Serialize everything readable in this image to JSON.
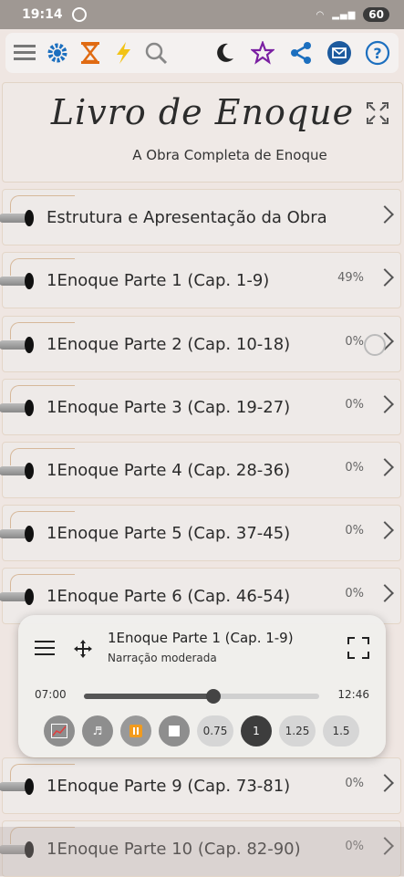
{
  "status": {
    "time": "19:14",
    "battery": "60"
  },
  "toolbar": {
    "left": [
      "menu-icon",
      "gear-icon",
      "hourglass-icon",
      "lightning-icon",
      "search-icon"
    ],
    "right": [
      "moon-icon",
      "star-icon",
      "share-icon",
      "mail-icon",
      "help-icon"
    ]
  },
  "header": {
    "title": "Livro de Enoque",
    "subtitle": "A Obra Completa de Enoque"
  },
  "rows": [
    {
      "label": "Estrutura e Apresentação da Obra",
      "pct": ""
    },
    {
      "label": "1Enoque Parte 1 (Cap. 1-9)",
      "pct": "49%"
    },
    {
      "label": "1Enoque Parte 2 (Cap. 10-18)",
      "pct": "0%"
    },
    {
      "label": "1Enoque Parte 3 (Cap. 19-27)",
      "pct": "0%"
    },
    {
      "label": "1Enoque Parte 4 (Cap. 28-36)",
      "pct": "0%"
    },
    {
      "label": "1Enoque Parte 5 (Cap. 37-45)",
      "pct": "0%"
    },
    {
      "label": "1Enoque Parte 6 (Cap. 46-54)",
      "pct": "0%"
    },
    {
      "label": "1Enoque Parte 9 (Cap. 73-81)",
      "pct": "0%"
    },
    {
      "label": "1Enoque Parte 10 (Cap. 82-90)",
      "pct": "0%"
    }
  ],
  "player": {
    "title": "1Enoque Parte 1 (Cap. 1-9)",
    "subtitle": "Narração moderada",
    "current": "07:00",
    "total": "12:46",
    "progress": 0.55,
    "speeds": [
      "0.75",
      "1",
      "1.25",
      "1.5"
    ],
    "active_speed": "1"
  }
}
